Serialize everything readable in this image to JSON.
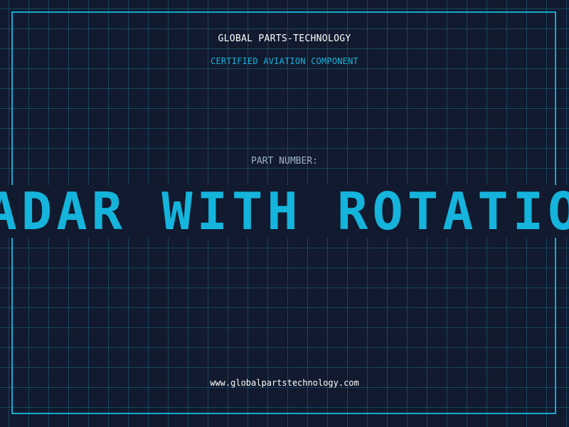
{
  "company": "GLOBAL PARTS-TECHNOLOGY",
  "subtitle": "CERTIFIED AVIATION COMPONENT",
  "part_number_label": "PART NUMBER:",
  "part_number_value": "RADAR WITH ROTATION",
  "website": "www.globalpartstechnology.com",
  "colors": {
    "background": "#111a2e",
    "accent": "#14b4dc",
    "grid": "#23788f"
  }
}
